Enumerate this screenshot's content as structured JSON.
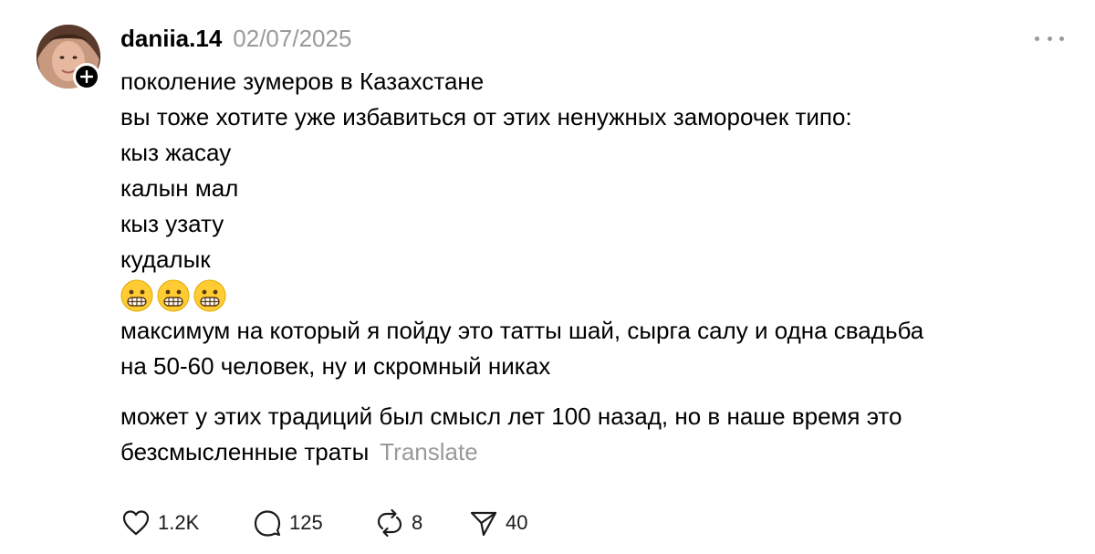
{
  "post": {
    "username": "daniia.14",
    "date": "02/07/2025",
    "lines": [
      "поколение зумеров в Казахстане",
      "вы тоже хотите уже избавиться от этих ненужных заморочек типо:",
      "кыз жасау",
      "калын мал",
      "кыз узату",
      "кудалык"
    ],
    "emoji": [
      "grimacing-face-emoji",
      "grimacing-face-emoji",
      "grimacing-face-emoji"
    ],
    "paragraph2": [
      "максимум на который я пойду это татты шай, сырга салу и одна свадьба",
      "на 50-60 человек, ну и скромный никах"
    ],
    "paragraph3": [
      "может у этих традиций был смысл лет 100 назад, но в наше время это",
      "безсмысленные траты"
    ],
    "translate_label": "Translate"
  },
  "actions": {
    "likes": "1.2K",
    "replies": "125",
    "reposts": "8",
    "shares": "40"
  },
  "icons": {
    "like": "heart-icon",
    "reply": "speech-bubble-icon",
    "repost": "repost-arrows-icon",
    "share": "paper-plane-icon",
    "more": "more-dots-icon",
    "follow": "plus-icon"
  },
  "colors": {
    "text": "#000000",
    "muted": "#9a9a9a",
    "background": "#ffffff"
  }
}
